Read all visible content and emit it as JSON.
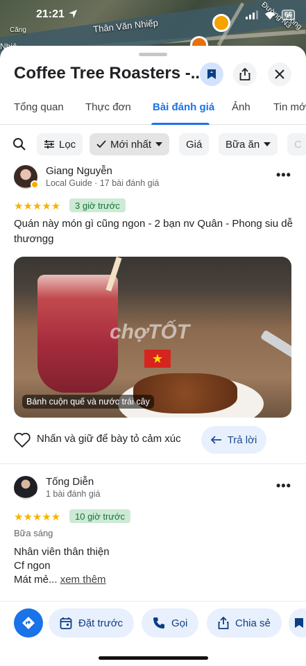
{
  "status_bar": {
    "time": "21:21",
    "battery": "66",
    "map_street": "Thân Văn Nhiếp",
    "map_street_2": "Đường N3",
    "map_street_3": "Đông",
    "map_label_left": "Căng",
    "map_label_left_2": "Nhiệ"
  },
  "place": {
    "title": "Coffee Tree Roasters -...",
    "save_icon": "bookmark-icon",
    "share_icon": "share-icon",
    "close_icon": "close-icon"
  },
  "tabs": [
    {
      "label": "Tổng quan",
      "active": false
    },
    {
      "label": "Thực đơn",
      "active": false
    },
    {
      "label": "Bài đánh giá",
      "active": true
    },
    {
      "label": "Ảnh",
      "active": false
    },
    {
      "label": "Tin mới",
      "active": false
    }
  ],
  "filters": {
    "search_icon": "search-icon",
    "chips": [
      "Lọc",
      "Mới nhất",
      "Giá",
      "Bữa ăn",
      "C"
    ]
  },
  "reviews": [
    {
      "name": "Giang Nguyễn",
      "meta": "Local Guide · 17 bài đánh giá",
      "rating": 5,
      "stars": "★★★★★",
      "time": "3 giờ trước",
      "text": "Quán này món gì cũng ngon - 2 bạn nv Quân - Phong siu dễ thươngg",
      "photo_caption": "Bánh cuộn quế và nước trái cây",
      "photo_watermark": "chợTỐT",
      "react_text": "Nhấn và giữ để bày tỏ cảm xúc",
      "reply_label": "Trả lời"
    },
    {
      "name": "Tống Diễn",
      "meta": "1 bài đánh giá",
      "rating": 5,
      "stars": "★★★★★",
      "time": "10 giờ trước",
      "meal": "Bữa sáng",
      "line1": "Nhân viên thân thiện",
      "line2": "Cf ngon",
      "line3": "Mát mẻ...",
      "see_more": "xem thêm"
    }
  ],
  "actions": {
    "directions_icon": "directions-icon",
    "book": "Đặt trước",
    "call": "Gọi",
    "share": "Chia sẻ"
  },
  "colors": {
    "accent": "#1a73e8",
    "star": "#f4b400",
    "badge_bg": "#ceead6",
    "badge_text": "#137333"
  }
}
